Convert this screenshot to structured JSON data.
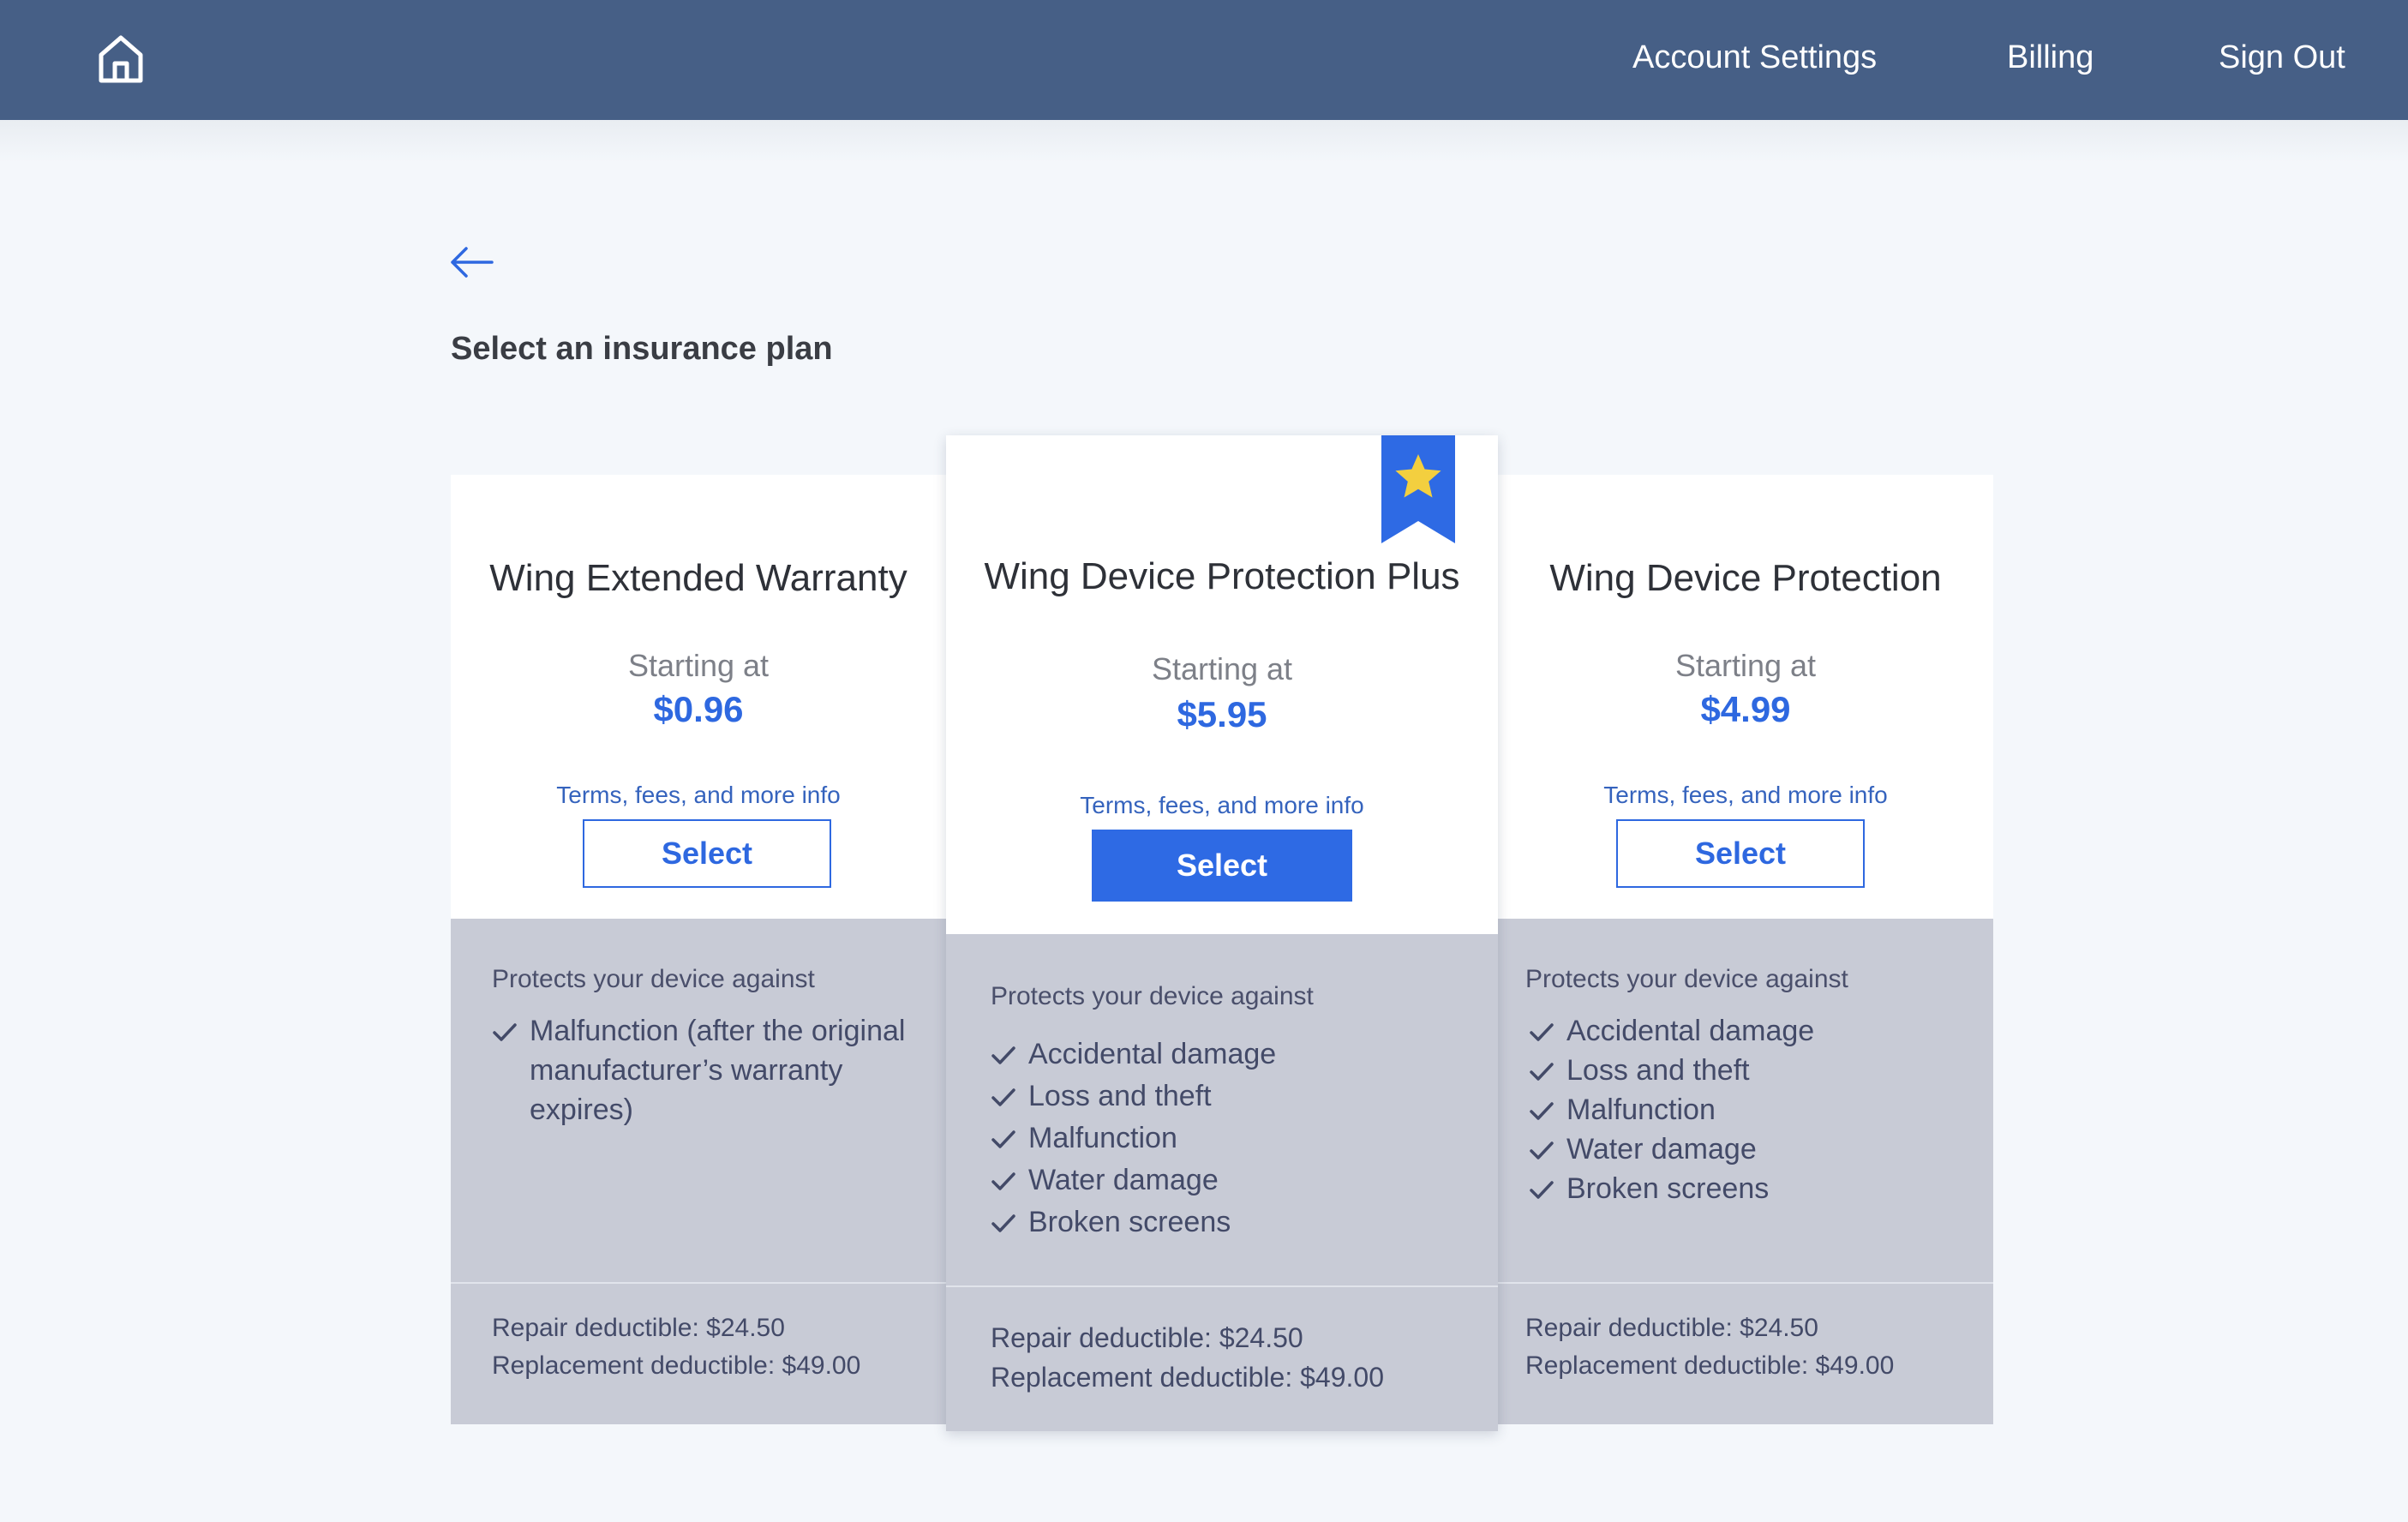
{
  "header": {
    "nav": [
      {
        "label": "Account Settings"
      },
      {
        "label": "Billing"
      },
      {
        "label": "Sign Out"
      }
    ]
  },
  "page": {
    "title": "Select an insurance plan"
  },
  "plans": [
    {
      "name": "Wing Extended Warranty",
      "starting_label": "Starting at",
      "price": "$0.96",
      "terms_link": "Terms, fees, and more info",
      "button_label": "Select",
      "protects_heading": "Protects your device against",
      "coverage": [
        "Malfunction (after the original manufacturer’s warranty expires)"
      ],
      "repair_deductible": "Repair deductible: $24.50",
      "replacement_deductible": "Replacement deductible: $49.00"
    },
    {
      "name": "Wing Device Protection Plus",
      "featured": true,
      "starting_label": "Starting at",
      "price": "$5.95",
      "terms_link": "Terms, fees, and more info",
      "button_label": "Select",
      "protects_heading": "Protects your device against",
      "coverage": [
        "Accidental damage",
        "Loss and theft",
        "Malfunction",
        "Water damage",
        "Broken screens"
      ],
      "repair_deductible": "Repair deductible: $24.50",
      "replacement_deductible": "Replacement deductible: $49.00"
    },
    {
      "name": "Wing Device Protection",
      "starting_label": "Starting at",
      "price": "$4.99",
      "terms_link": "Terms, fees, and more info",
      "button_label": "Select",
      "protects_heading": "Protects your device against",
      "coverage": [
        "Accidental damage",
        "Loss and theft",
        "Malfunction",
        "Water damage",
        "Broken screens"
      ],
      "repair_deductible": "Repair deductible: $24.50",
      "replacement_deductible": "Replacement deductible: $49.00"
    }
  ],
  "icons": {
    "home": "home-icon",
    "back": "back-arrow-icon",
    "check": "check-icon",
    "featured": "star-ribbon-icon"
  },
  "colors": {
    "header_bg": "#465f86",
    "accent": "#2e68e0",
    "panel_bg": "#c8cbd6",
    "ribbon": "#2e6ae4",
    "star": "#f3cf3f"
  }
}
